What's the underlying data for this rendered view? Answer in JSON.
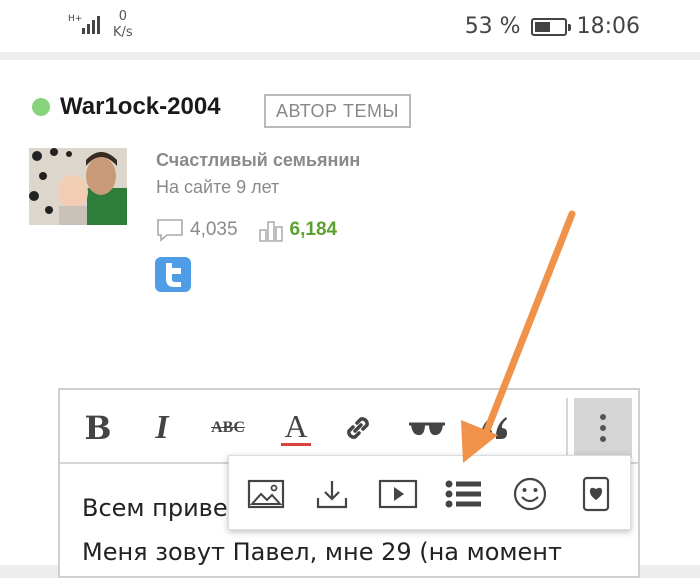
{
  "status_bar": {
    "network_type": "H+",
    "data_speed_value": "0",
    "data_speed_unit": "K/s",
    "battery_percent": "53 %",
    "battery_level": 0.53,
    "time": "18:06"
  },
  "post": {
    "username": "War1ock-2004",
    "author_badge": "АВТОР ТЕМЫ",
    "user_title": "Счастливый семьянин",
    "user_since": "На сайте 9 лет",
    "posts_count": "4,035",
    "reputation": "6,184",
    "online_color": "#87d37c"
  },
  "editor": {
    "toolbar": {
      "bold": "B",
      "italic": "I",
      "strike": "ABC",
      "font_color": "A"
    },
    "lines": [
      "Всем приве",
      "Меня зовут Павел, мне 29 (на момент"
    ]
  },
  "popup_menu": {
    "items": [
      "image-icon",
      "download-icon",
      "video-icon",
      "list-icon",
      "emoji-icon",
      "spoiler-icon"
    ]
  },
  "colors": {
    "arrow": "#f0924a",
    "twitter": "#4e9de6",
    "reputation": "#5ba12f"
  }
}
